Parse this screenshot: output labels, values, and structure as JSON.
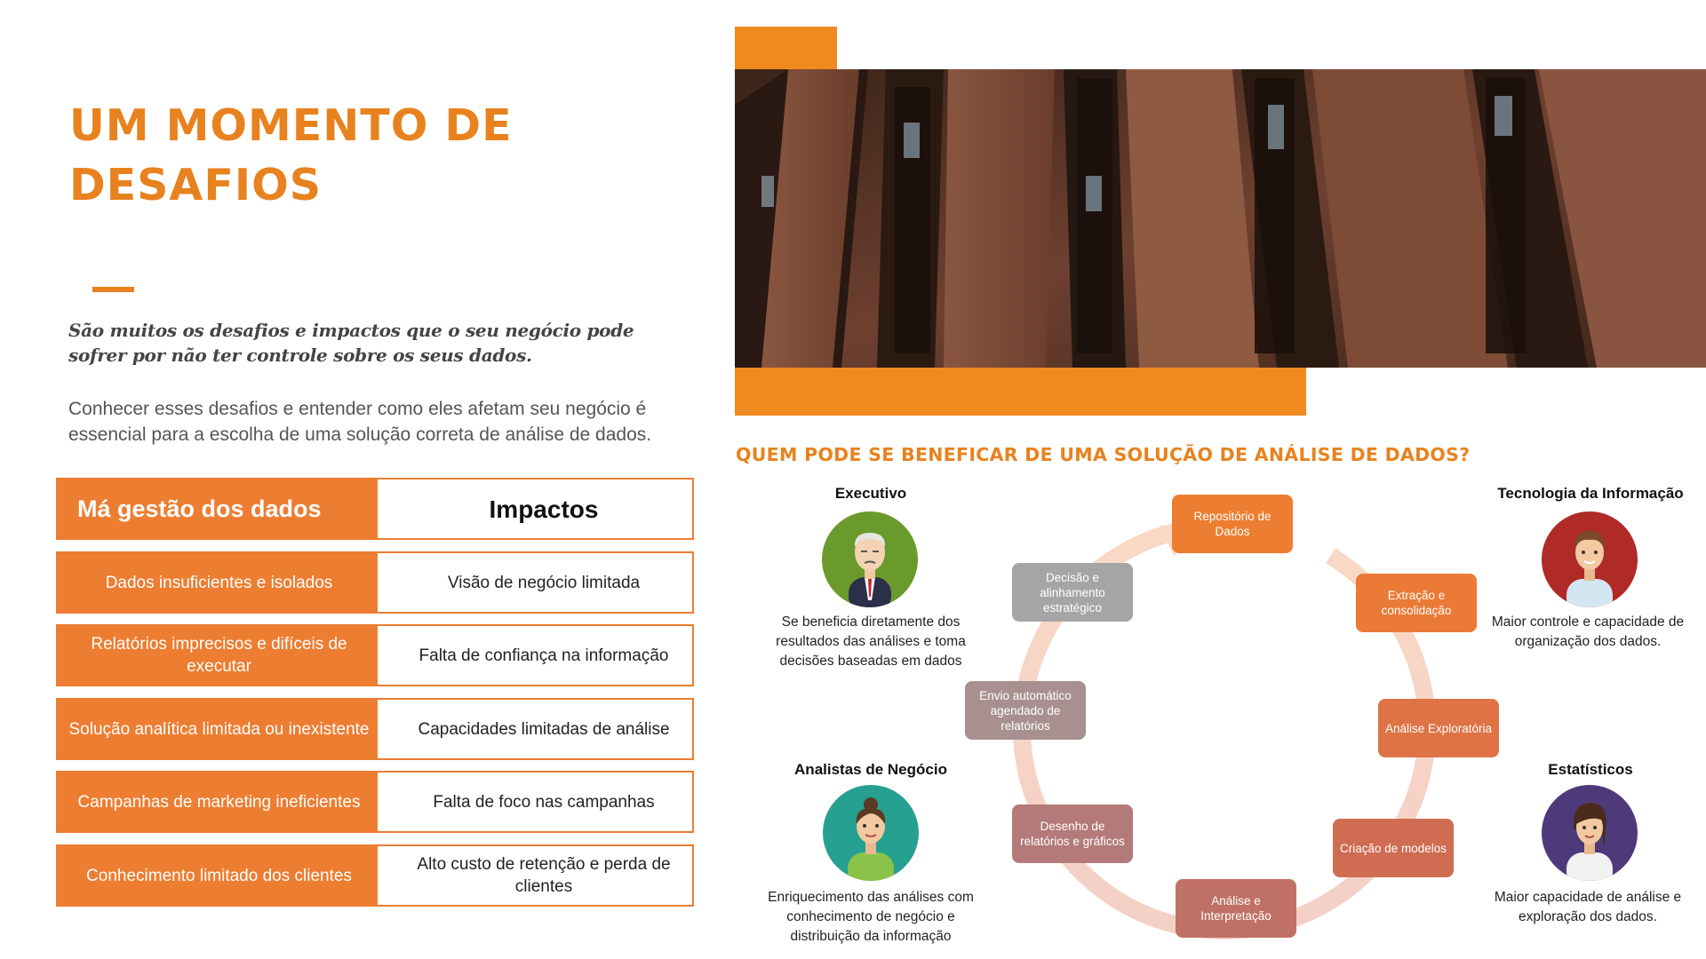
{
  "title": {
    "line1": "UM MOMENTO DE",
    "line2": "DESAFIOS"
  },
  "lead": "São muitos os desafios e impactos que o seu negócio pode sofrer por não ter controle sobre os seus dados.",
  "paragraph": "Conhecer esses desafios e entender como eles afetam seu negócio é essencial para a escolha de uma solução correta de análise de dados.",
  "table": {
    "head_left": "Má gestão dos dados",
    "head_right": "Impactos",
    "rows": [
      {
        "problem": "Dados insuficientes e isolados",
        "impact": "Visão de negócio limitada"
      },
      {
        "problem": "Relatórios imprecisos e difíceis de executar",
        "impact": "Falta de confiança na informação"
      },
      {
        "problem": "Solução analítica limitada ou inexistente",
        "impact": "Capacidades limitadas de análise"
      },
      {
        "problem": "Campanhas de marketing ineficientes",
        "impact": "Falta de foco nas campanhas"
      },
      {
        "problem": "Conhecimento limitado dos clientes",
        "impact": "Alto custo de retenção e perda de clientes"
      }
    ]
  },
  "subtitle": "QUEM PODE SE BENEFICAR DE UMA SOLUÇÃO DE ANÁLISE DE DADOS?",
  "roles": {
    "executivo": {
      "name": "Executivo",
      "desc": "Se beneficia diretamente dos resultados das análises e toma decisões baseadas em dados"
    },
    "ti": {
      "name": "Tecnologia da Informação",
      "desc": "Maior controle e capacidade de organização dos dados."
    },
    "analistas": {
      "name": "Analistas de Negócio",
      "desc": "Enriquecimento das análises com conhecimento de negócio e distribuição da informação"
    },
    "estatisticos": {
      "name": "Estatísticos",
      "desc": "Maior capacidade de análise e exploração dos dados."
    }
  },
  "cycle": [
    {
      "label": "Repositório de Dados",
      "color": "#ed7d31"
    },
    {
      "label": "Extração e consolidação",
      "color": "#ea7a35"
    },
    {
      "label": "Análise Exploratória",
      "color": "#df7345"
    },
    {
      "label": "Criação de modelos",
      "color": "#d06c52"
    },
    {
      "label": "Análise e Interpretação",
      "color": "#c07165"
    },
    {
      "label": "Desenho de relatórios e gráficos",
      "color": "#b47a7a"
    },
    {
      "label": "Envio automático agendado de relatórios",
      "color": "#a89090"
    },
    {
      "label": "Decisão e alinhamento estratégico",
      "color": "#a5a5a5"
    }
  ],
  "colors": {
    "accent": "#e8821e",
    "arrow": "#ed7d31"
  }
}
